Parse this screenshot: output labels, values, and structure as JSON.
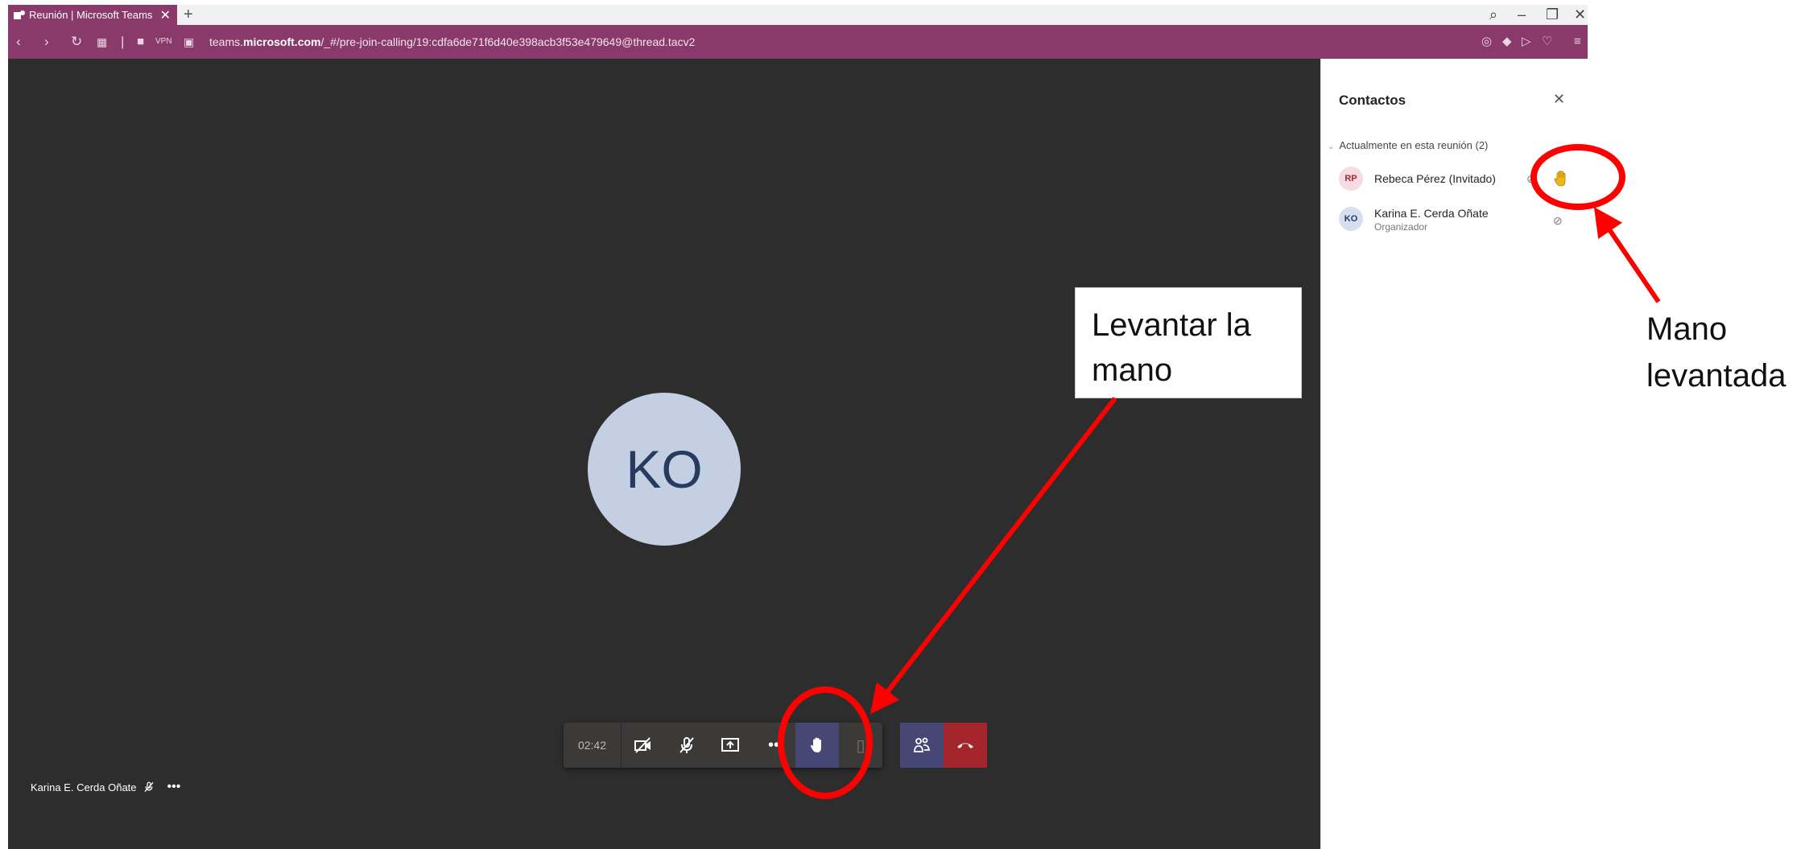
{
  "browser": {
    "tab_title": "Reunión | Microsoft Teams",
    "tab_close": "✕",
    "new_tab": "+",
    "vpn_badge": "VPN",
    "url_prefix": "teams.",
    "url_domain": "microsoft.com",
    "url_path": "/_#/pre-join-calling/19:cdfa6de71f6d40e398acb3f53e479649@thread.tacv2"
  },
  "stage": {
    "avatar_initials": "KO",
    "self_name": "Karina E. Cerda Oñate"
  },
  "callbar": {
    "timer": "02:42"
  },
  "panel": {
    "title": "Contactos",
    "section": "Actualmente en esta reunión (2)",
    "participants": [
      {
        "initials": "RP",
        "name": "Rebeca Pérez (Invitado)",
        "role": "",
        "avatar_bg": "#f6dbe3",
        "avatar_fg": "#a4262c",
        "hand_raised": true
      },
      {
        "initials": "KO",
        "name": "Karina E. Cerda Oñate",
        "role": "Organizador",
        "avatar_bg": "#d6dff0",
        "avatar_fg": "#263b5e",
        "hand_raised": false
      }
    ]
  },
  "annotations": {
    "callout_line1": "Levantar la",
    "callout_line2": "mano",
    "right_line1": "Mano",
    "right_line2": "levantada",
    "color": "#ff0000"
  }
}
